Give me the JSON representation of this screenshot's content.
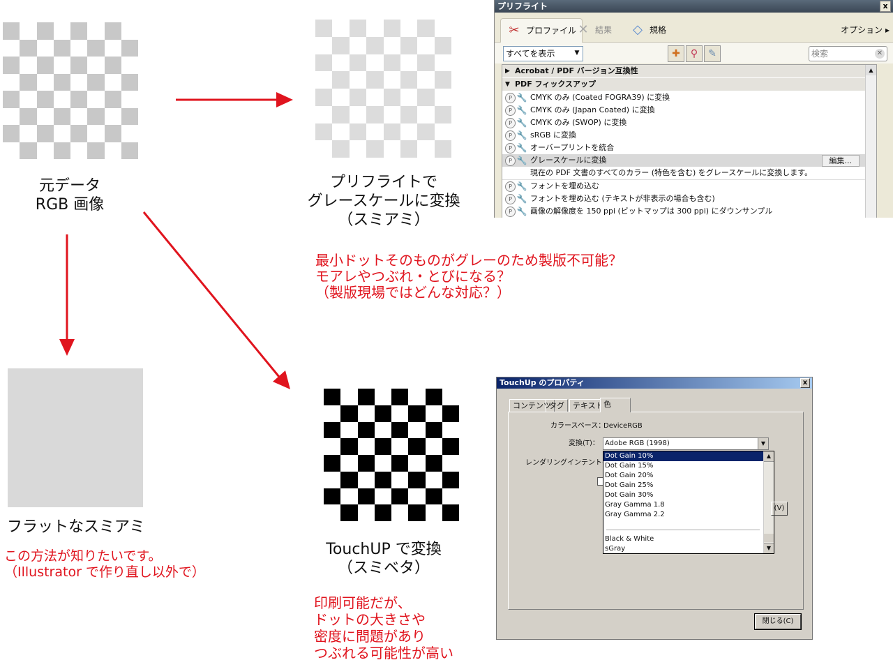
{
  "colors": {
    "arrow_red": "#e0141e",
    "checker_original": "#c8c8c8",
    "checker_preflight": "#dcdcdc",
    "checker_touchup": "#000000",
    "flat_gray": "#d9d9d9"
  },
  "labels": {
    "original_line1": "元データ",
    "original_line2": "RGB 画像",
    "preflight_line1": "プリフライトで",
    "preflight_line2": "グレースケールに変換",
    "preflight_line3": "（スミアミ）",
    "flat_label": "フラットなスミアミ",
    "touchup_line1": "TouchUP で変換",
    "touchup_line2": "（スミベタ）"
  },
  "notes": {
    "question": [
      "最小ドットそのものがグレーのため製版不可能？",
      "モアレやつぶれ・とびになる？",
      "（製版現場ではどんな対応？）"
    ],
    "wish": [
      "この方法が知りたいです。",
      "（Illustrator で作り直し以外で）"
    ],
    "printable": [
      "印刷可能だが、",
      "ドットの大きさや",
      "密度に問題があり",
      "つぶれる可能性が高い"
    ]
  },
  "preflight": {
    "title": "プリフライト",
    "close": "x",
    "tabs": [
      {
        "label": "プロファイル",
        "icon": "profile-icon"
      },
      {
        "label": "結果",
        "icon": "results-icon"
      },
      {
        "label": "規格",
        "icon": "standards-icon"
      }
    ],
    "options": "オプション ▸",
    "show_select": "すべてを表示",
    "search_placeholder": "検索",
    "groups": {
      "acrobat": "Acrobat / PDF バージョン互換性",
      "fixups": "PDF フィックスアップ"
    },
    "items": [
      "CMYK のみ (Coated FOGRA39) に変換",
      "CMYK のみ (Japan Coated) に変換",
      "CMYK のみ (SWOP) に変換",
      "sRGB に変換",
      "オーバープリントを統合",
      "グレースケールに変換",
      "フォントを埋め込む",
      "フォントを埋め込む (テキストが非表示の場合も含む)",
      "画像の解像度を 150 ppi (ビットマップは 300 ppi) にダウンサンプル"
    ],
    "selected_desc": "現在の PDF 文書のすべてのカラー (特色を含む) をグレースケールに変換します。",
    "edit_button": "編集..."
  },
  "touchup": {
    "title": "TouchUp のプロパティ",
    "close": "x",
    "tabs": [
      "コンテンツ",
      "タグ",
      "テキスト",
      "色"
    ],
    "colorspace_label": "カラースペース：",
    "colorspace_value": "DeviceRGB",
    "convert_label": "変換(T)：",
    "convert_value": "Adobe RGB (1998)",
    "intent_label": "レンダリングインテント(I)：",
    "options": [
      "Dot Gain 10%",
      "Dot Gain 15%",
      "Dot Gain 20%",
      "Dot Gain 25%",
      "Dot Gain 30%",
      "Gray Gamma 1.8",
      "Gray Gamma 2.2"
    ],
    "options2": [
      "Black & White",
      "sGray"
    ],
    "v_button": "(V)",
    "close_button": "閉じる(C)"
  }
}
